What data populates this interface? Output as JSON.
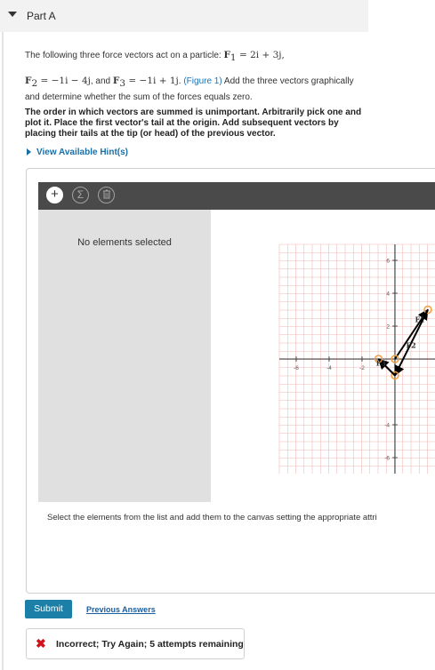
{
  "part": {
    "title": "Part A"
  },
  "problem": {
    "intro": "The following three force vectors act on a particle:",
    "f1_label": "F",
    "f1_sub": "1",
    "f1_eq": " = 2i + 3j,",
    "f2_label": "F",
    "f2_sub": "2",
    "f2_eq": " = −1i − 4j",
    "and_text": ", and ",
    "f3_label": "F",
    "f3_sub": "3",
    "f3_eq": " = −1i + 1j",
    "dot": ". ",
    "figure_link": "(Figure 1)",
    "after_link": " Add the three vectors graphically and determine whether the sum of the forces equals zero.",
    "bold_instruction": "The order in which vectors are summed is unimportant. Arbitrarily pick one and plot it. Place the first vector's tail at the origin. Add subsequent vectors by placing their tails at the tip (or head) of the previous vector."
  },
  "hint": {
    "label": "View Available Hint(s)"
  },
  "tool": {
    "toolbar": {
      "add_icon": "+",
      "sum_icon": "Σ",
      "delete_icon": "trash"
    },
    "list_empty_text": "No elements selected",
    "instruction": "Select the elements from the list and add them to the canvas setting the appropriate attri",
    "axis": {
      "x_ticks": [
        "-6",
        "-4",
        "-2"
      ],
      "y_ticks": [
        "6",
        "4",
        "2",
        "-4",
        "-6"
      ]
    },
    "vector_labels": {
      "f1": "F1",
      "f2": "F2",
      "f3": "F3"
    },
    "vectors": [
      {
        "name": "F1",
        "x": 2,
        "y": 3
      },
      {
        "name": "F2",
        "x": -2,
        "y": -4
      },
      {
        "name": "F3",
        "x": -1,
        "y": 1
      }
    ],
    "colors": {
      "grid": "#f2b8b8",
      "vector": "#000000",
      "handle": "#f0a040"
    }
  },
  "actions": {
    "submit_label": "Submit",
    "previous_answers_label": "Previous Answers"
  },
  "feedback": {
    "icon": "✖",
    "message": "Incorrect; Try Again; 5 attempts remaining",
    "color": "#d0141b"
  }
}
